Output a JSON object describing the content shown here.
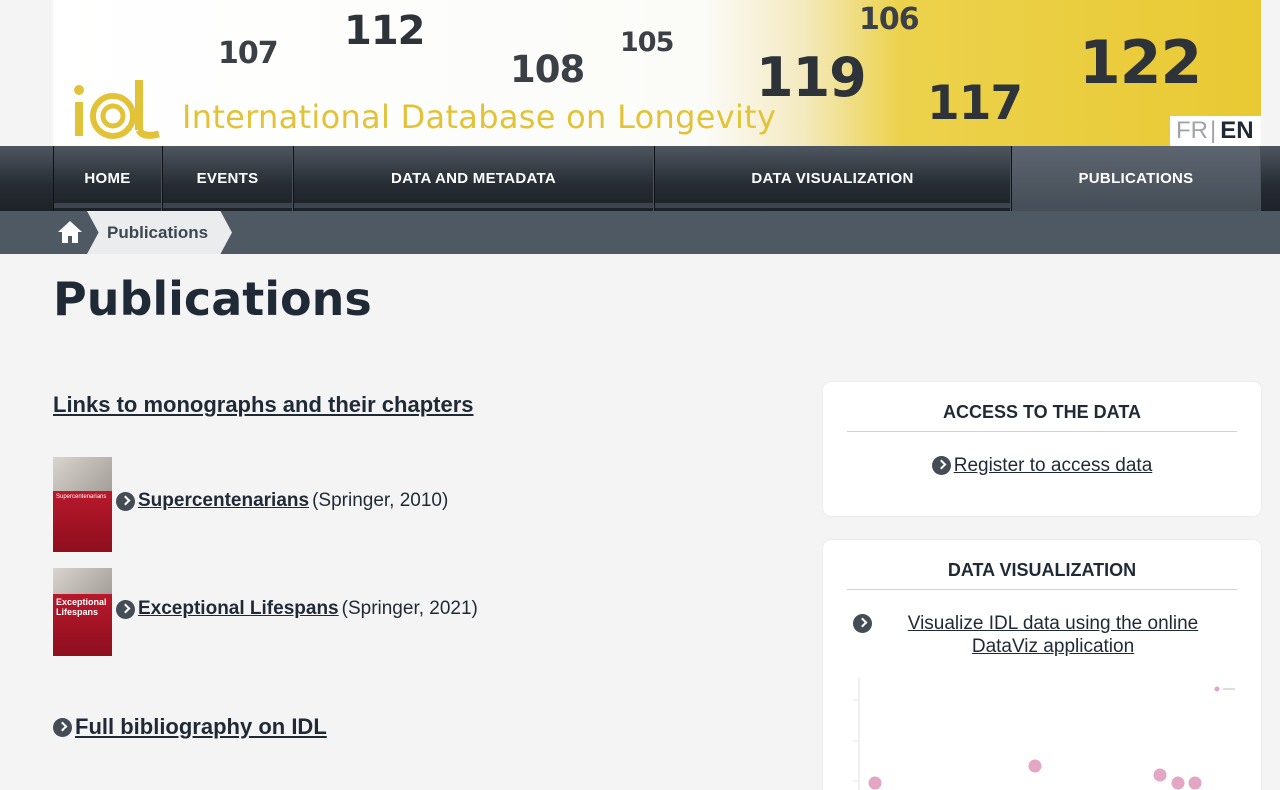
{
  "banner": {
    "numbers": [
      "107",
      "112",
      "108",
      "105",
      "119",
      "106",
      "117",
      "122"
    ],
    "site_title": "International Database on Longevity",
    "lang": {
      "fr": "FR",
      "separator": "|",
      "en": "EN"
    },
    "colors": {
      "logo": "#e2c338",
      "gradient_end": "#e9c933"
    }
  },
  "nav": {
    "items": [
      {
        "label": "HOME"
      },
      {
        "label": "EVENTS"
      },
      {
        "label": "DATA AND METADATA"
      },
      {
        "label": "DATA VISUALIZATION"
      },
      {
        "label": "PUBLICATIONS",
        "active": true
      }
    ]
  },
  "breadcrumb": {
    "home_icon": "home-icon",
    "current": "Publications"
  },
  "main": {
    "page_title": "Publications",
    "section_link": "Links to monographs and their chapters",
    "books": [
      {
        "cover_title": "Supercentenarians",
        "title": "Supercentenarians",
        "detail": "(Springer, 2010)"
      },
      {
        "cover_title": "Exceptional Lifespans",
        "title": "Exceptional Lifespans",
        "detail": "(Springer, 2021)"
      }
    ],
    "bibliography_link": "Full bibliography on IDL"
  },
  "sidebar": {
    "access": {
      "heading": "ACCESS TO THE DATA",
      "link": "Register to access data"
    },
    "dataviz": {
      "heading": "DATA VISUALIZATION",
      "link": "Visualize IDL data using the online DataViz application",
      "preview_point_color": "#e3a6c4"
    }
  }
}
